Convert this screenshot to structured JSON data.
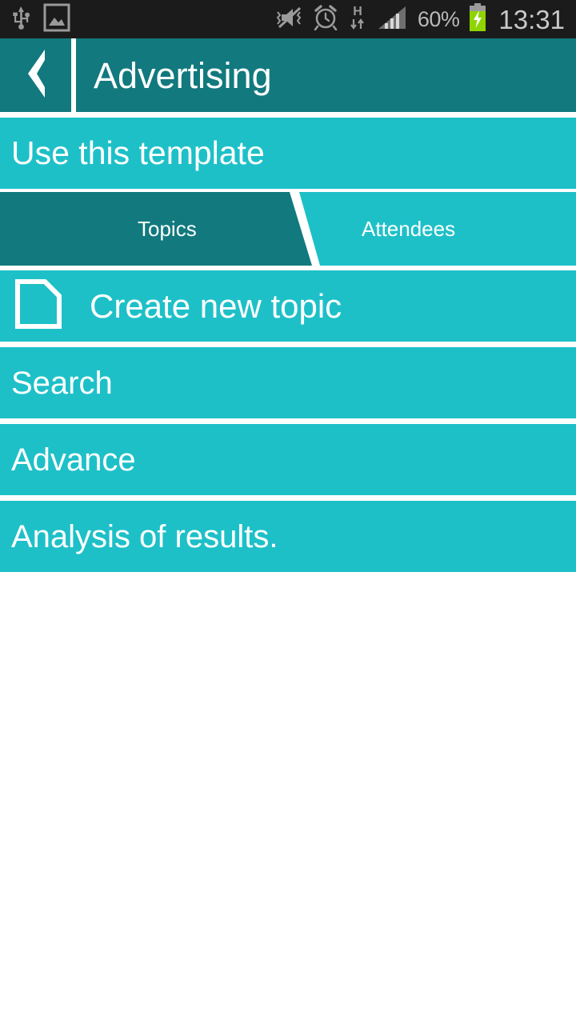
{
  "statusbar": {
    "left_icons": [
      "usb-icon",
      "screenshot-image-icon"
    ],
    "right_icons": [
      "mute-vibrate-icon",
      "alarm-clock-icon",
      "hspa-data-icon",
      "signal-bars-icon"
    ],
    "network_type": "H",
    "battery_percent": "60%",
    "battery_state": "charging",
    "clock": "13:31"
  },
  "header": {
    "back_label": "back",
    "title": "Advertising"
  },
  "template_bar": {
    "label": "Use this template"
  },
  "tabs": [
    {
      "label": "Topics",
      "active": true
    },
    {
      "label": "Attendees",
      "active": false
    }
  ],
  "list": [
    {
      "label": "Create new topic",
      "icon": "document-icon"
    },
    {
      "label": "Search",
      "icon": null
    },
    {
      "label": "Advance",
      "icon": null
    },
    {
      "label": "Analysis of results.",
      "icon": null
    }
  ],
  "colors": {
    "accent_light": "#1ec0c8",
    "accent_dark": "#12797e",
    "statusbar_bg": "#1b1b1b",
    "text_on_accent": "#ffffff",
    "battery_green": "#8fd400",
    "page_bg": "#ffffff"
  }
}
